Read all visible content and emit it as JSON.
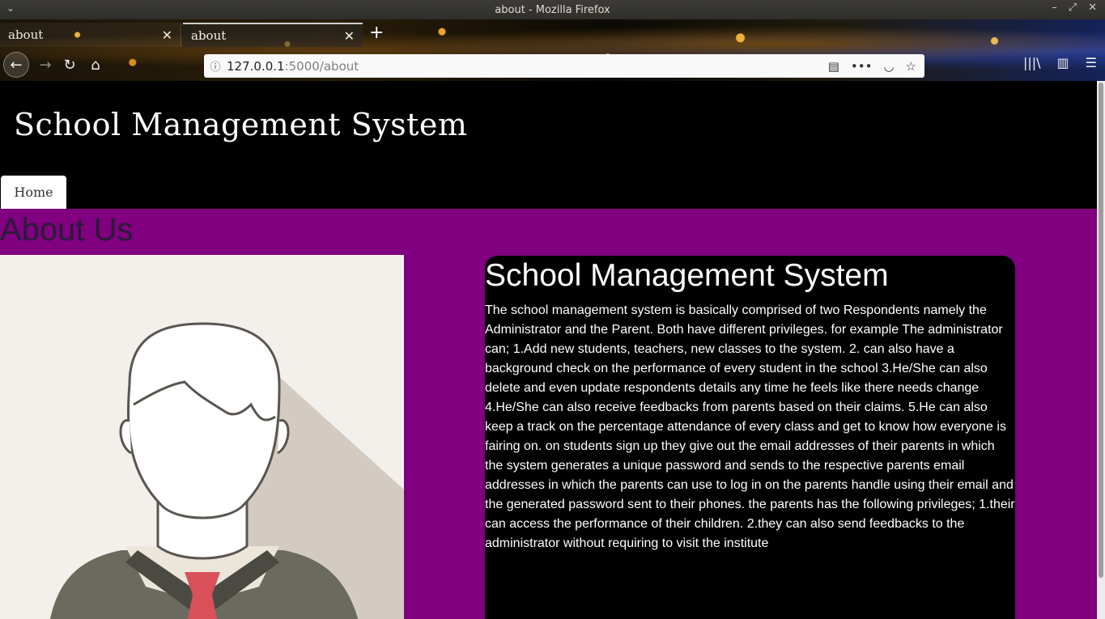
{
  "window": {
    "title": "about - Mozilla Firefox"
  },
  "tabs": [
    {
      "label": "about",
      "close": "✕"
    },
    {
      "label": "about",
      "close": "✕"
    }
  ],
  "nav": {
    "new_tab": "+",
    "back": "←",
    "forward": "→",
    "reload": "↻",
    "home": "⌂"
  },
  "urlbar": {
    "host": "127.0.0.1",
    "path": ":5000/about"
  },
  "site": {
    "title": "School Management System",
    "nav_home": "Home"
  },
  "about": {
    "heading": "About Us",
    "card_title": "School Management System",
    "card_body": "The school management system is basically comprised of two Respondents namely the Administrator and the Parent. Both have different privileges. for example The administrator can; 1.Add new students, teachers, new classes to the system. 2. can also have a background check on the performance of every student in the school 3.He/She can also delete and even update respondents details any time he feels like there needs change 4.He/She can also receive feedbacks from parents based on their claims. 5.He can also keep a track on the percentage attendance of every class and get to know how everyone is fairing on. on students sign up they give out the email addresses of their parents in which the system generates a unique password and sends to the respective parents email addresses in which the parents can use to log in on the parents handle using their email and the generated password sent to their phones. the parents has the following privileges; 1.their can access the performance of their children. 2.they can also send feedbacks to the administrator without requiring to visit the institute"
  },
  "colors": {
    "header_bg": "#000000",
    "content_bg": "#800080",
    "card_bg": "#000000"
  }
}
